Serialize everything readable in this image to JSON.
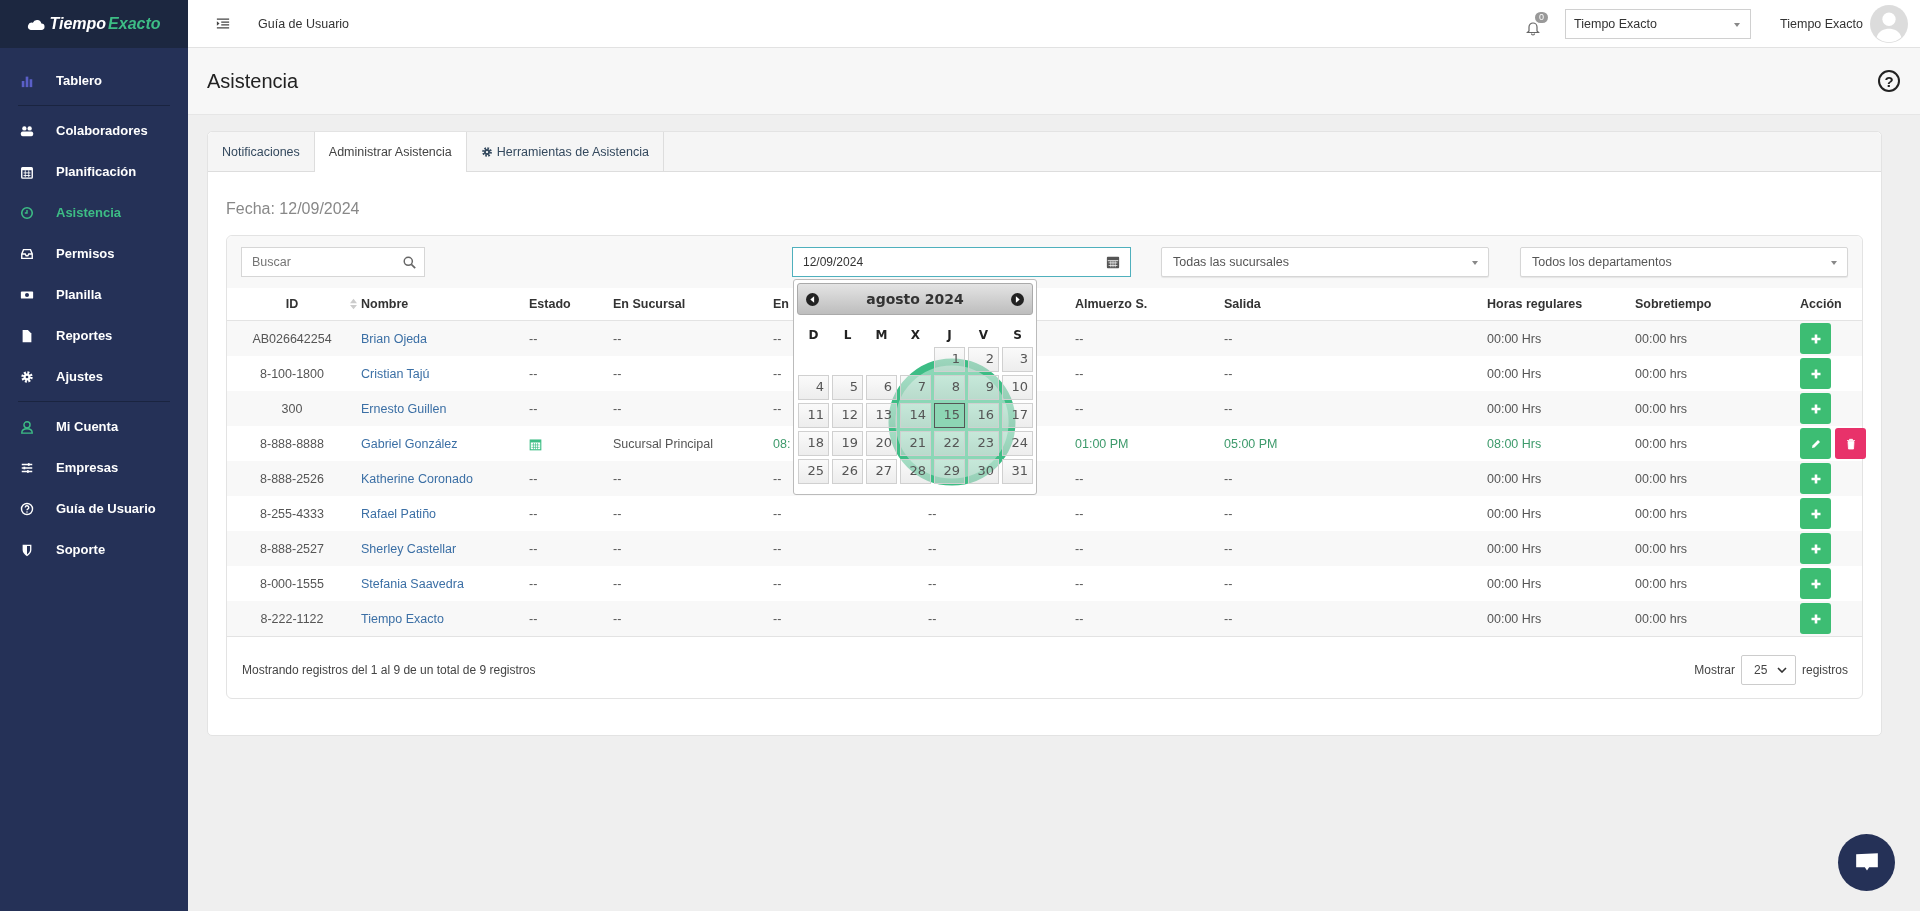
{
  "brand": {
    "first": "Tiempo",
    "second": "Exacto"
  },
  "topbar": {
    "title": "Guía de Usuario",
    "notifications": "0",
    "company_select": "Tiempo Exacto",
    "user_name": "Tiempo Exacto"
  },
  "sidebar": {
    "items": [
      {
        "label": "Tablero",
        "selected": false,
        "divider_after": true
      },
      {
        "label": "Colaboradores",
        "selected": false,
        "divider_after": false
      },
      {
        "label": "Planificación",
        "selected": false,
        "divider_after": false
      },
      {
        "label": "Asistencia",
        "selected": true,
        "divider_after": false
      },
      {
        "label": "Permisos",
        "selected": false,
        "divider_after": false
      },
      {
        "label": "Planilla",
        "selected": false,
        "divider_after": false
      },
      {
        "label": "Reportes",
        "selected": false,
        "divider_after": false
      },
      {
        "label": "Ajustes",
        "selected": false,
        "divider_after": true
      },
      {
        "label": "Mi Cuenta",
        "selected": false,
        "divider_after": false
      },
      {
        "label": "Empresas",
        "selected": false,
        "divider_after": false
      },
      {
        "label": "Guía de Usuario",
        "selected": false,
        "divider_after": false
      },
      {
        "label": "Soporte",
        "selected": false,
        "divider_after": false
      }
    ]
  },
  "page": {
    "title": "Asistencia",
    "help_glyph": "?"
  },
  "tabs": [
    {
      "label": "Notificaciones",
      "selected": false,
      "icon": false
    },
    {
      "label": "Administrar Asistencia",
      "selected": true,
      "icon": false
    },
    {
      "label": "Herramientas de Asistencia",
      "selected": false,
      "icon": true
    }
  ],
  "date_label": "Fecha: 12/09/2024",
  "filters": {
    "search_placeholder": "Buscar",
    "date": "12/09/2024",
    "branch": "Todas las sucursales",
    "department": "Todos los departamentos"
  },
  "calendar": {
    "title": "agosto 2024",
    "weekdays": [
      "D",
      "L",
      "M",
      "X",
      "J",
      "V",
      "S"
    ],
    "days": [
      {
        "day": "1",
        "selected": false
      },
      {
        "day": "2",
        "selected": false
      },
      {
        "day": "3",
        "selected": false
      },
      {
        "day": "4",
        "selected": false
      },
      {
        "day": "5",
        "selected": false
      },
      {
        "day": "6",
        "selected": false
      },
      {
        "day": "7",
        "selected": false
      },
      {
        "day": "8",
        "selected": false
      },
      {
        "day": "9",
        "selected": false
      },
      {
        "day": "10",
        "selected": false
      },
      {
        "day": "11",
        "selected": false
      },
      {
        "day": "12",
        "selected": false
      },
      {
        "day": "13",
        "selected": false
      },
      {
        "day": "14",
        "selected": false
      },
      {
        "day": "15",
        "selected": true
      },
      {
        "day": "16",
        "selected": false
      },
      {
        "day": "17",
        "selected": false
      },
      {
        "day": "18",
        "selected": false
      },
      {
        "day": "19",
        "selected": false
      },
      {
        "day": "20",
        "selected": false
      },
      {
        "day": "21",
        "selected": false
      },
      {
        "day": "22",
        "selected": false
      },
      {
        "day": "23",
        "selected": false
      },
      {
        "day": "24",
        "selected": false
      },
      {
        "day": "25",
        "selected": false
      },
      {
        "day": "26",
        "selected": false
      },
      {
        "day": "27",
        "selected": false
      },
      {
        "day": "28",
        "selected": false
      },
      {
        "day": "29",
        "selected": false
      },
      {
        "day": "30",
        "selected": false
      },
      {
        "day": "31",
        "selected": false
      }
    ],
    "highlight": true
  },
  "table": {
    "columns": [
      "ID",
      "Nombre",
      "Estado",
      "En Sucursal",
      "En",
      null,
      "Almuerzo S.",
      "Salida",
      "Horas regulares",
      "Sobretiempo",
      "Acción"
    ],
    "rows": [
      {
        "cells": [
          "AB026642254",
          "Brian Ojeda",
          "--",
          "--",
          "--",
          null,
          "--",
          "--",
          "00:00 Hrs",
          "00:00 hrs"
        ],
        "scheduled": false,
        "actions": [
          {
            "kind": "add"
          }
        ]
      },
      {
        "cells": [
          "8-100-1800",
          "Cristian Tajú",
          "--",
          "--",
          "--",
          null,
          "--",
          "--",
          "00:00 Hrs",
          "00:00 hrs"
        ],
        "scheduled": false,
        "actions": [
          {
            "kind": "add"
          }
        ]
      },
      {
        "cells": [
          "300",
          "Ernesto Guillen",
          "--",
          "--",
          "--",
          null,
          "--",
          "--",
          "00:00 Hrs",
          "00:00 hrs"
        ],
        "scheduled": false,
        "actions": [
          {
            "kind": "add"
          }
        ]
      },
      {
        "cells": [
          "8-888-8888",
          "Gabriel González",
          null,
          "Sucursal Principal",
          "08:",
          null,
          "01:00 PM",
          "05:00 PM",
          "08:00 Hrs",
          "00:00 hrs"
        ],
        "scheduled": true,
        "actions": [
          {
            "kind": "edit"
          },
          {
            "kind": "delete"
          }
        ]
      },
      {
        "cells": [
          "8-888-2526",
          "Katherine Coronado",
          "--",
          "--",
          "--",
          null,
          "--",
          "--",
          "00:00 Hrs",
          "00:00 hrs"
        ],
        "scheduled": false,
        "actions": [
          {
            "kind": "add"
          }
        ]
      },
      {
        "cells": [
          "8-255-4333",
          "Rafael Patiño",
          "--",
          "--",
          "--",
          "--",
          "--",
          "--",
          "00:00 Hrs",
          "00:00 hrs"
        ],
        "scheduled": false,
        "actions": [
          {
            "kind": "add"
          }
        ]
      },
      {
        "cells": [
          "8-888-2527",
          "Sherley Castellar",
          "--",
          "--",
          "--",
          "--",
          "--",
          "--",
          "00:00 Hrs",
          "00:00 hrs"
        ],
        "scheduled": false,
        "actions": [
          {
            "kind": "add"
          }
        ]
      },
      {
        "cells": [
          "8-000-1555",
          "Stefania Saavedra",
          "--",
          "--",
          "--",
          "--",
          "--",
          "--",
          "00:00 Hrs",
          "00:00 hrs"
        ],
        "scheduled": false,
        "actions": [
          {
            "kind": "add"
          }
        ]
      },
      {
        "cells": [
          "8-222-1122",
          "Tiempo Exacto",
          "--",
          "--",
          "--",
          "--",
          "--",
          "--",
          "00:00 Hrs",
          "00:00 hrs"
        ],
        "scheduled": false,
        "actions": [
          {
            "kind": "add"
          }
        ]
      }
    ]
  },
  "footer": {
    "summary": "Mostrando registros del 1 al 9 de un total de 9 registros",
    "show_label": "Mostrar",
    "page_size": "25",
    "records_label": "registros"
  }
}
